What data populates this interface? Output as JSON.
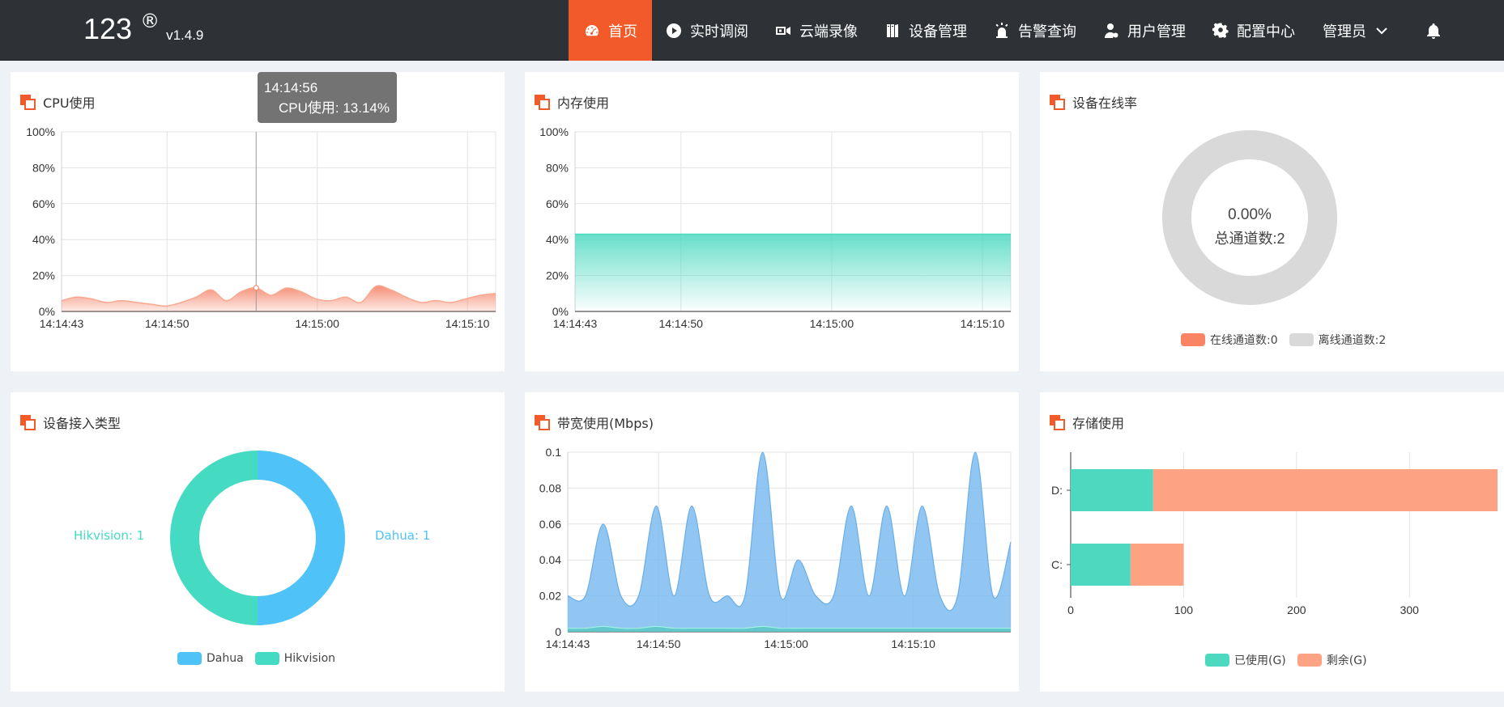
{
  "header": {
    "brand": "123",
    "reg": "®",
    "version": "v1.4.9",
    "nav": [
      {
        "label": "首页",
        "icon": "dashboard-icon",
        "active": true
      },
      {
        "label": "实时调阅",
        "icon": "play-circle-icon"
      },
      {
        "label": "云端录像",
        "icon": "video-camera-icon"
      },
      {
        "label": "设备管理",
        "icon": "device-icon"
      },
      {
        "label": "告警查询",
        "icon": "alarm-icon"
      },
      {
        "label": "用户管理",
        "icon": "user-icon"
      },
      {
        "label": "配置中心",
        "icon": "gear-icon"
      }
    ],
    "user": "管理员",
    "colors": {
      "bar": "#2e3237",
      "active": "#f25a2a"
    }
  },
  "panels": {
    "cpu": {
      "title": "CPU使用"
    },
    "memory": {
      "title": "内存使用"
    },
    "online": {
      "title": "设备在线率",
      "center_value": "0.00%",
      "center_label": "总通道数:2",
      "legend": [
        "在线通道数:0",
        "离线通道数:2"
      ]
    },
    "device_type": {
      "title": "设备接入类型",
      "label_left": "Hikvision: 1",
      "label_right": "Dahua: 1",
      "legend": [
        "Dahua",
        "Hikvision"
      ]
    },
    "bandwidth": {
      "title": "带宽使用(Mbps)"
    },
    "storage": {
      "title": "存储使用",
      "legend": [
        "已使用(G)",
        "剩余(G)"
      ]
    }
  },
  "tooltip": {
    "time": "14:14:56",
    "text": "CPU使用: 13.14%"
  },
  "chart_data": [
    {
      "id": "cpu",
      "type": "area",
      "title": "CPU使用",
      "x_ticks": [
        "14:14:43",
        "14:14:50",
        "14:15:00",
        "14:15:10"
      ],
      "y_ticks": [
        "100%",
        "80%",
        "60%",
        "40%",
        "20%",
        "0%"
      ],
      "ylim": [
        0,
        100
      ],
      "x": [
        "14:14:43",
        "14:14:44",
        "14:14:45",
        "14:14:46",
        "14:14:47",
        "14:14:48",
        "14:14:49",
        "14:14:50",
        "14:14:51",
        "14:14:52",
        "14:14:53",
        "14:14:54",
        "14:14:55",
        "14:14:56",
        "14:14:57",
        "14:14:58",
        "14:14:59",
        "14:15:00",
        "14:15:01",
        "14:15:02",
        "14:15:03",
        "14:15:04",
        "14:15:05",
        "14:15:06",
        "14:15:07",
        "14:15:08",
        "14:15:09",
        "14:15:10",
        "14:15:11",
        "14:15:12"
      ],
      "values": [
        6,
        8,
        7,
        5,
        6,
        5,
        4,
        3,
        5,
        8,
        12,
        6,
        11,
        13.14,
        9,
        13,
        11,
        7,
        6,
        8,
        5,
        14,
        12,
        8,
        5,
        6,
        5,
        7,
        9,
        10
      ],
      "color": "#f47b5e",
      "grid": true
    },
    {
      "id": "memory",
      "type": "area",
      "title": "内存使用",
      "x_ticks": [
        "14:14:43",
        "14:14:50",
        "14:15:00",
        "14:15:10"
      ],
      "y_ticks": [
        "100%",
        "80%",
        "60%",
        "40%",
        "20%",
        "0%"
      ],
      "ylim": [
        0,
        100
      ],
      "values": [
        43,
        43
      ],
      "color": "#4dd9c0",
      "grid": true
    },
    {
      "id": "online",
      "type": "pie",
      "title": "设备在线率",
      "series": [
        {
          "name": "在线通道数:0",
          "value": 0,
          "color": "#f98463"
        },
        {
          "name": "离线通道数:2",
          "value": 2,
          "color": "#d9d9d9"
        }
      ]
    },
    {
      "id": "device_type",
      "type": "pie",
      "title": "设备接入类型",
      "series": [
        {
          "name": "Dahua",
          "value": 1,
          "color": "#4fc3f7"
        },
        {
          "name": "Hikvision",
          "value": 1,
          "color": "#45dbc3"
        }
      ]
    },
    {
      "id": "bandwidth",
      "type": "area",
      "title": "带宽使用(Mbps)",
      "x_ticks": [
        "14:14:43",
        "14:14:50",
        "14:15:00",
        "14:15:10"
      ],
      "y_ticks": [
        "0.1",
        "0.08",
        "0.06",
        "0.04",
        "0.02",
        "0"
      ],
      "ylim": [
        0,
        0.1
      ],
      "series": [
        {
          "values": [
            0.02,
            0.02,
            0.06,
            0.02,
            0.02,
            0.07,
            0.02,
            0.07,
            0.02,
            0.02,
            0.02,
            0.1,
            0.02,
            0.04,
            0.02,
            0.02,
            0.07,
            0.02,
            0.07,
            0.02,
            0.07,
            0.02,
            0.02,
            0.1,
            0.02,
            0.05
          ],
          "color": "#7cbcee"
        },
        {
          "values": [
            0.002,
            0.002,
            0.003,
            0.002,
            0.002,
            0.003,
            0.002,
            0.002,
            0.002,
            0.002,
            0.002,
            0.003,
            0.002,
            0.002,
            0.002,
            0.002,
            0.002,
            0.002,
            0.002,
            0.002,
            0.002,
            0.002,
            0.002,
            0.002,
            0.002,
            0.002
          ],
          "color": "#45c9b2"
        }
      ],
      "grid": true
    },
    {
      "id": "storage",
      "type": "bar",
      "orientation": "horizontal",
      "title": "存储使用",
      "categories": [
        "D:",
        "C:"
      ],
      "x_ticks": [
        "0",
        "100",
        "200",
        "300"
      ],
      "xlim": [
        0,
        378
      ],
      "series": [
        {
          "name": "已使用(G)",
          "values": [
            73,
            53
          ],
          "color": "#4dd9c0"
        },
        {
          "name": "剩余(G)",
          "values": [
            305,
            47
          ],
          "color": "#fda384"
        }
      ]
    }
  ]
}
